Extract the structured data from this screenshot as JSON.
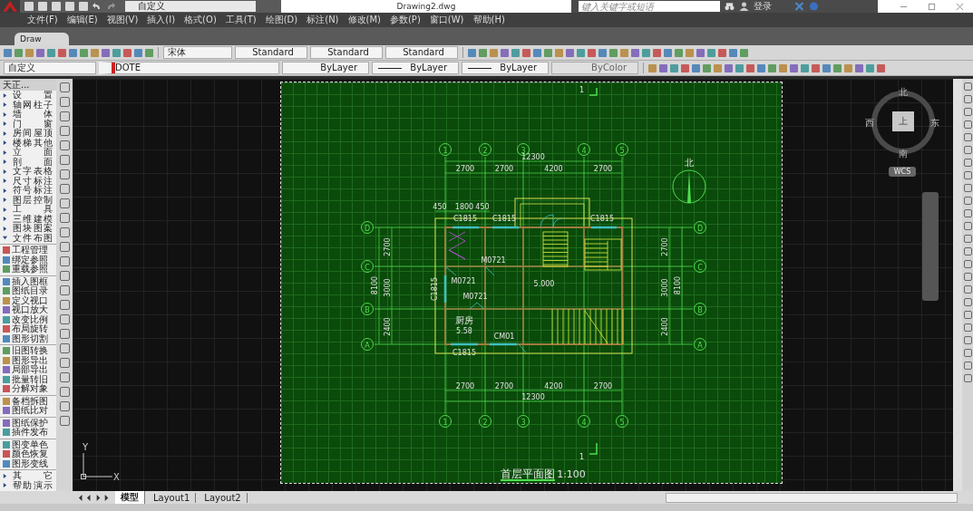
{
  "title_bar": {
    "workspace": "自定义",
    "title": "Drawing2.dwg",
    "search_placeholder": "键入关键字或短语",
    "login": "登录"
  },
  "menu": [
    "文件(F)",
    "编辑(E)",
    "视图(V)",
    "插入(I)",
    "格式(O)",
    "工具(T)",
    "绘图(D)",
    "标注(N)",
    "修改(M)",
    "参数(P)",
    "窗口(W)",
    "帮助(H)"
  ],
  "file_tabs": [
    {
      "label": "Draw",
      "selected": true
    }
  ],
  "toolbar_1": {
    "text_font": "宋体",
    "styles": [
      "Standard",
      "Standard",
      "Standard"
    ]
  },
  "toolbar_2": {
    "workspace": "自定义",
    "layer": "DOTE",
    "properties": [
      {
        "label": "ByLayer",
        "disabled": false,
        "kind": "plain"
      },
      {
        "label": "ByLayer",
        "disabled": false,
        "kind": "line"
      },
      {
        "label": "ByLayer",
        "disabled": false,
        "kind": "line"
      },
      {
        "label": "ByColor",
        "disabled": true,
        "kind": "plain"
      }
    ]
  },
  "sidebar": {
    "title": "天正...",
    "groups": [
      {
        "label": "设置",
        "expanded": false
      },
      {
        "label": "轴网柱子",
        "expanded": false
      },
      {
        "label": "墙体",
        "expanded": false
      },
      {
        "label": "门窗",
        "expanded": false
      },
      {
        "label": "房间屋顶",
        "expanded": false
      },
      {
        "label": "楼梯其他",
        "expanded": false
      },
      {
        "label": "立面",
        "expanded": false
      },
      {
        "label": "剖面",
        "expanded": false
      },
      {
        "label": "文字表格",
        "expanded": false
      },
      {
        "label": "尺寸标注",
        "expanded": false
      },
      {
        "label": "符号标注",
        "expanded": false
      },
      {
        "label": "图层控制",
        "expanded": false
      },
      {
        "label": "工具",
        "expanded": false
      },
      {
        "label": "三维建模",
        "expanded": false
      },
      {
        "label": "图块图案",
        "expanded": false
      },
      {
        "label": "文件布图",
        "expanded": true,
        "sections": [
          [
            "工程管理",
            "绑定参照",
            "重载参照"
          ],
          [
            "插入图框",
            "图纸目录",
            "定义视口",
            "视口放大",
            "改变比例",
            "布局旋转",
            "图形切割"
          ],
          [
            "旧图转换",
            "图形导出",
            "局部导出",
            "批量转旧",
            "分解对象"
          ],
          [
            "备档拆图",
            "图纸比对"
          ],
          [
            "图纸保护",
            "插件发布"
          ],
          [
            "图变单色",
            "颜色恢复",
            "图形变线"
          ]
        ]
      },
      {
        "label": "其它",
        "expanded": false
      },
      {
        "label": "帮助演示",
        "expanded": false
      }
    ]
  },
  "drawing": {
    "top_axes": [
      "1",
      "2",
      "3",
      "4",
      "5"
    ],
    "bottom_axes": [
      "1",
      "2",
      "3",
      "4",
      "5"
    ],
    "left_axes": [
      "D",
      "C",
      "B",
      "A"
    ],
    "right_axes": [
      "D",
      "C",
      "B",
      "A"
    ],
    "top_dims": {
      "overall": "12300",
      "spans": [
        "2700",
        "2700",
        "4200",
        "2700"
      ]
    },
    "bottom_dims": {
      "overall": "12300",
      "spans": [
        "2700",
        "2700",
        "4200",
        "2700"
      ]
    },
    "left_dims": {
      "overall": "8100",
      "spans": [
        "2700",
        "3000",
        "2400"
      ]
    },
    "right_dims": {
      "overall": "8100",
      "spans": [
        "2700",
        "3000",
        "2400"
      ]
    },
    "window_dims": [
      "450",
      "1800",
      "450"
    ],
    "labels": [
      "C1815",
      "C1815",
      "C1815",
      "M0721",
      "M0721",
      "C1815",
      "M0721",
      "5.000",
      "厨房",
      "5.58",
      "CM01",
      "C1815"
    ],
    "north": "北",
    "section_marks": [
      "1",
      "1"
    ],
    "title": "首层平面图",
    "scale": "1:100"
  },
  "view_cube": {
    "north": "北",
    "west": "西",
    "east": "东",
    "south": "南",
    "face": "上",
    "ucs": "WCS"
  },
  "ucs_icon": {
    "y": "Y",
    "x": "X"
  },
  "layout_tabs": [
    {
      "label": "模型",
      "selected": true
    },
    {
      "label": "Layout1",
      "selected": false
    },
    {
      "label": "Layout2",
      "selected": false
    }
  ]
}
